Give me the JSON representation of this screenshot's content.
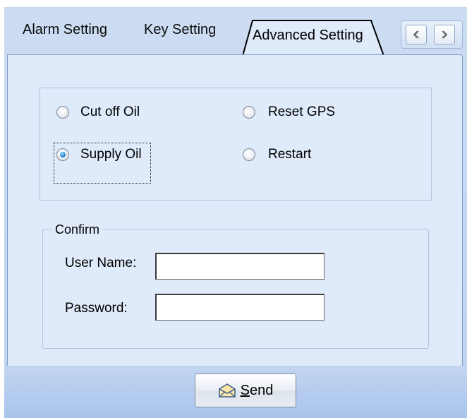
{
  "tabs": [
    {
      "label": "Alarm Setting",
      "active": false
    },
    {
      "label": "Key Setting",
      "active": false
    },
    {
      "label": "Advanced Setting",
      "active": true
    }
  ],
  "tab_scroll": {
    "left_icon": "chevron-left-icon",
    "right_icon": "chevron-right-icon"
  },
  "options": {
    "cut_off_oil": {
      "label": "Cut off Oil",
      "checked": false
    },
    "supply_oil": {
      "label": "Supply Oil",
      "checked": true
    },
    "reset_gps": {
      "label": "Reset GPS",
      "checked": false
    },
    "restart": {
      "label": "Restart",
      "checked": false
    }
  },
  "confirm": {
    "legend": "Confirm",
    "user_name_label": "User Name:",
    "user_name_value": "",
    "password_label": "Password:",
    "password_value": ""
  },
  "send_button": {
    "mnemonic": "S",
    "rest": "end",
    "icon": "envelope-icon"
  },
  "colors": {
    "panel": "#dfeafa",
    "window": "#c7d8f1",
    "radio_selected": "#2a86d6"
  }
}
